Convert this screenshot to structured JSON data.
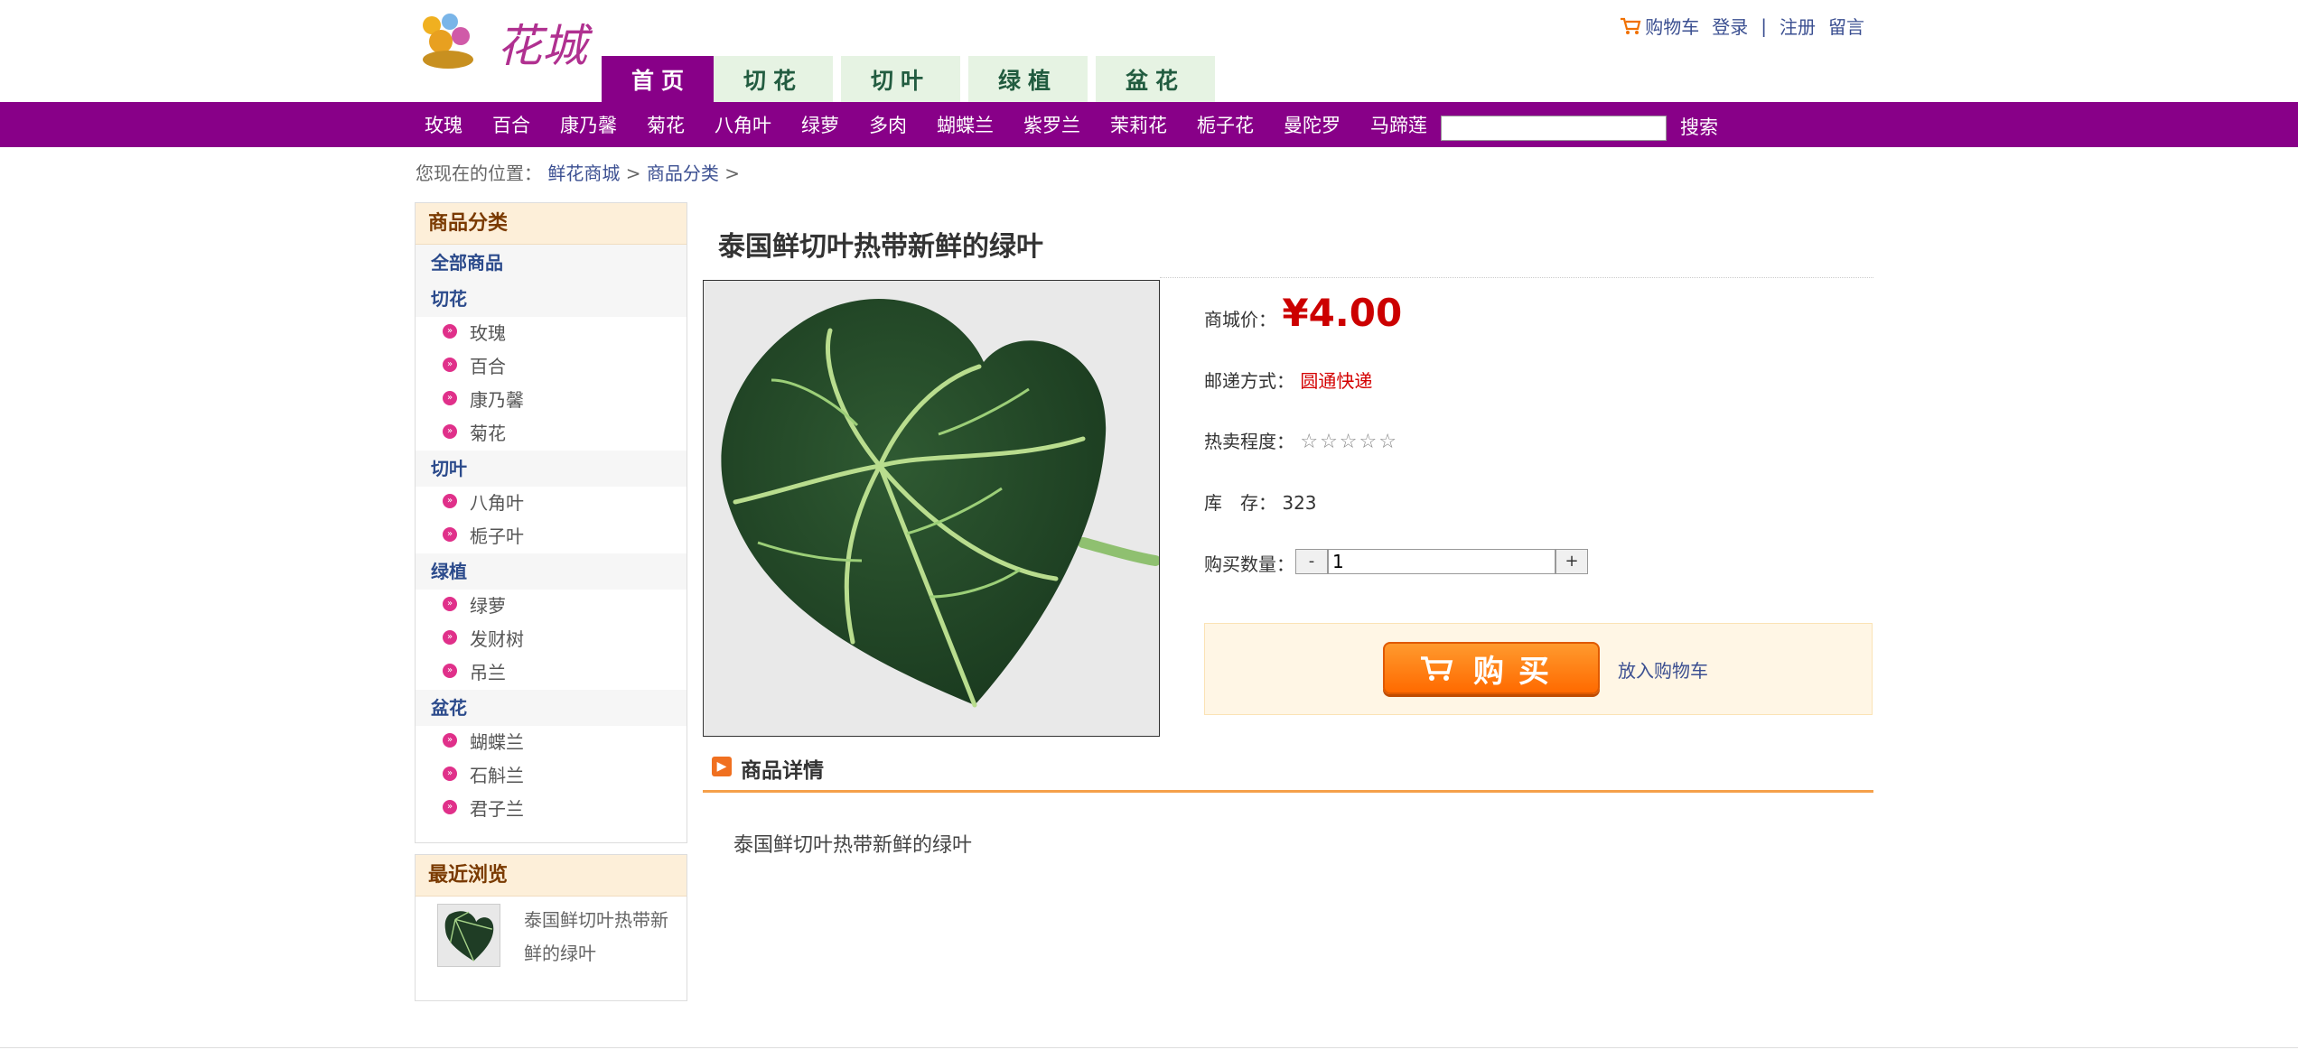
{
  "header": {
    "logo_text": "花城",
    "tabs": [
      "首页",
      "切花",
      "切叶",
      "绿植",
      "盆花"
    ],
    "active_tab": "首页",
    "links": {
      "cart": "购物车",
      "login": "登录",
      "separator": "|",
      "register": "注册",
      "message": "留言"
    }
  },
  "nav": {
    "items": [
      "玫瑰",
      "百合",
      "康乃馨",
      "菊花",
      "八角叶",
      "绿萝",
      "多肉",
      "蝴蝶兰",
      "紫罗兰",
      "茉莉花",
      "栀子花",
      "曼陀罗",
      "马蹄莲"
    ],
    "search_value": "",
    "search_label": "搜索"
  },
  "breadcrumb": {
    "prefix": "您现在的位置：",
    "items": [
      "鲜花商城",
      "商品分类"
    ],
    "sep": ">"
  },
  "sidebar": {
    "title": "商品分类",
    "all_label": "全部商品",
    "groups": [
      {
        "name": "切花",
        "items": [
          "玫瑰",
          "百合",
          "康乃馨",
          "菊花"
        ]
      },
      {
        "name": "切叶",
        "items": [
          "八角叶",
          "栀子叶"
        ]
      },
      {
        "name": "绿植",
        "items": [
          "绿萝",
          "发财树",
          "吊兰"
        ]
      },
      {
        "name": "盆花",
        "items": [
          "蝴蝶兰",
          "石斛兰",
          "君子兰"
        ]
      }
    ],
    "recent_title": "最近浏览",
    "recent_item": "泰国鲜切叶热带新鲜的绿叶"
  },
  "product": {
    "title": "泰国鲜切叶热带新鲜的绿叶",
    "price_label": "商城价：",
    "price": "¥4.00",
    "shipping_label": "邮递方式：",
    "shipping": "圆通快递",
    "hot_label": "热卖程度：",
    "stars": "☆☆☆☆☆",
    "rating": 0,
    "stock_label": "库　存：",
    "stock": "323",
    "qty_label": "购买数量：",
    "qty": "1",
    "minus": "-",
    "plus": "+",
    "buy_label": "购买",
    "add_cart": "放入购物车",
    "detail_title": "商品详情",
    "detail_text": "泰国鲜切叶热带新鲜的绿叶"
  },
  "colors": {
    "brand_purple": "#880088",
    "tab_bg": "#e6f3e3",
    "price_red": "#cc0000",
    "buy_orange": "#ff7a10"
  }
}
